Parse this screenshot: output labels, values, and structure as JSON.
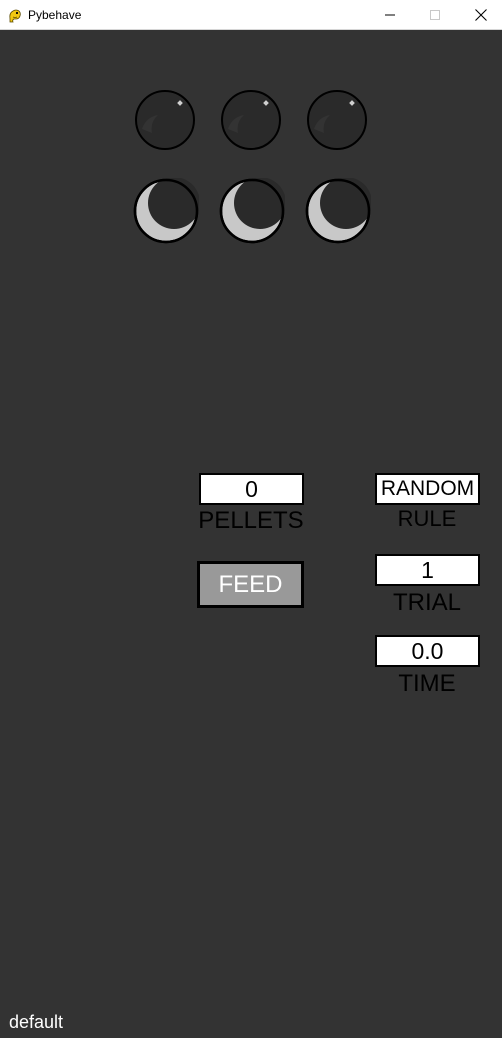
{
  "window": {
    "title": "Pybehave",
    "icon": "python-snake-icon"
  },
  "controls": {
    "minimize_icon": "minimize-icon",
    "maximize_icon": "maximize-icon",
    "close_icon": "close-icon"
  },
  "indicators": {
    "nose_pokes": [
      {
        "name": "nose-poke-1",
        "state": "off"
      },
      {
        "name": "nose-poke-2",
        "state": "off"
      },
      {
        "name": "nose-poke-3",
        "state": "off"
      }
    ],
    "food_troughs": [
      {
        "name": "food-trough-1",
        "state": "off"
      },
      {
        "name": "food-trough-2",
        "state": "off"
      },
      {
        "name": "food-trough-3",
        "state": "off"
      }
    ]
  },
  "pellets": {
    "value": "0",
    "label": "PELLETS"
  },
  "feed_button": {
    "label": "FEED"
  },
  "rule": {
    "value": "RANDOM",
    "label": "RULE"
  },
  "trial": {
    "value": "1",
    "label": "TRIAL"
  },
  "time": {
    "value": "0.0",
    "label": "TIME"
  },
  "status": {
    "text": "default"
  },
  "colors": {
    "background": "#333333",
    "indicator_dark": "#2a2a2a",
    "indicator_light": "#c8c8c8",
    "button_fill": "#999999"
  }
}
